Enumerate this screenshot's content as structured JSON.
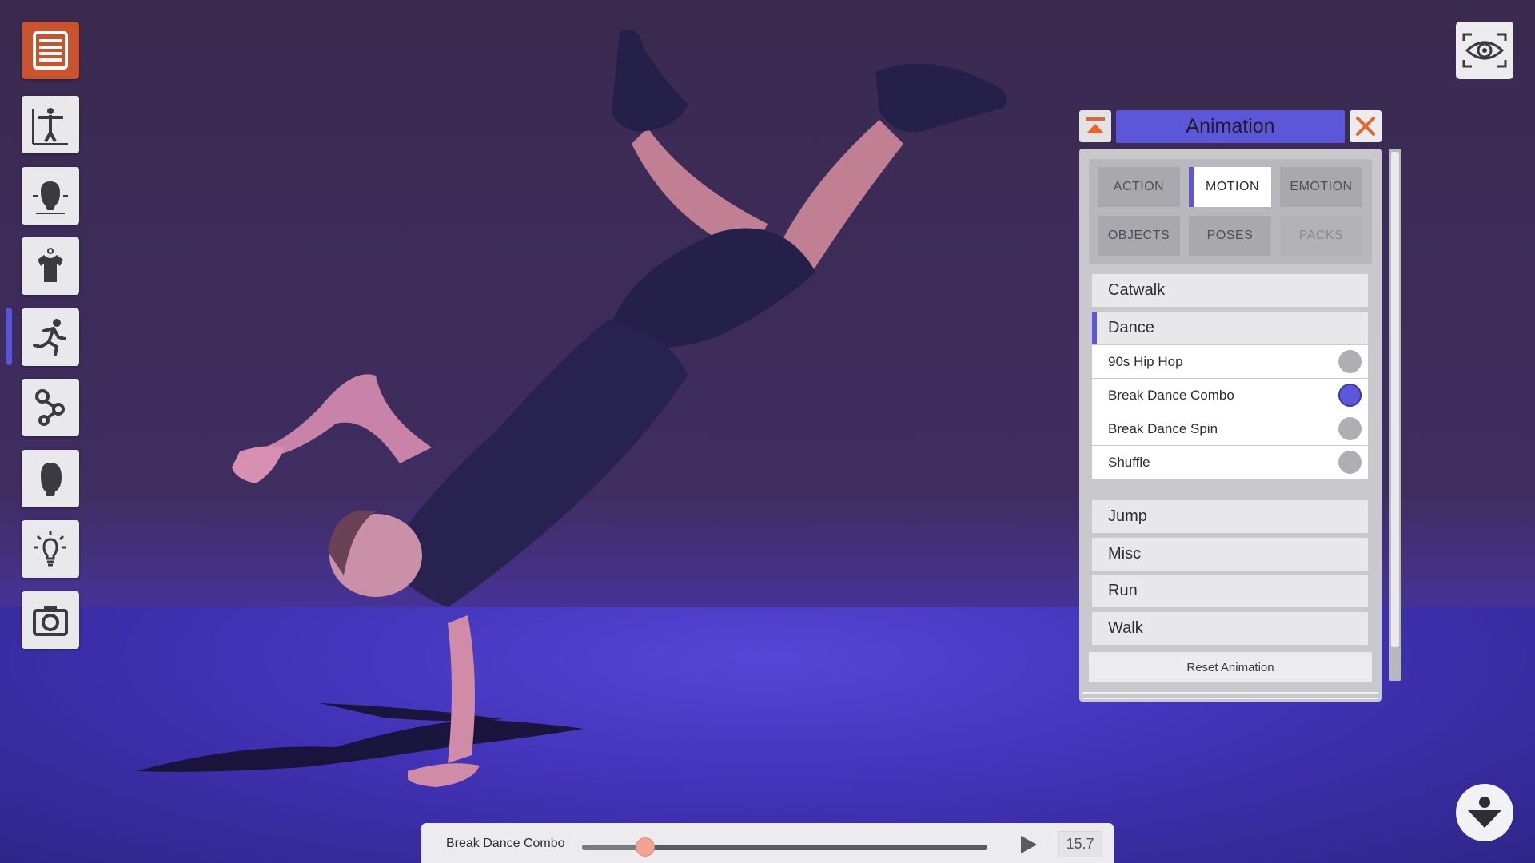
{
  "toolbar": {
    "items": [
      {
        "icon": "menu-icon"
      },
      {
        "icon": "body-proportions-icon"
      },
      {
        "icon": "head-proportions-icon"
      },
      {
        "icon": "clothing-icon"
      },
      {
        "icon": "animation-runner-icon"
      },
      {
        "icon": "joints-icon"
      },
      {
        "icon": "head-icon"
      },
      {
        "icon": "lighting-icon"
      },
      {
        "icon": "camera-icon"
      }
    ],
    "active_index": 4
  },
  "view": {
    "eye_icon": "eye-icon"
  },
  "panel": {
    "title": "Animation",
    "tabs": [
      {
        "label": "ACTION",
        "state": "normal"
      },
      {
        "label": "MOTION",
        "state": "active"
      },
      {
        "label": "EMOTION",
        "state": "normal"
      },
      {
        "label": "OBJECTS",
        "state": "normal"
      },
      {
        "label": "POSES",
        "state": "normal"
      },
      {
        "label": "PACKS",
        "state": "disabled"
      }
    ],
    "categories_top": [
      {
        "label": "Catwalk"
      },
      {
        "label": "Dance",
        "expanded": true
      }
    ],
    "dance_items": [
      {
        "label": "90s Hip Hop",
        "selected": false
      },
      {
        "label": "Break Dance Combo",
        "selected": true
      },
      {
        "label": "Break Dance Spin",
        "selected": false
      },
      {
        "label": "Shuffle",
        "selected": false
      }
    ],
    "categories_bottom": [
      {
        "label": "Jump"
      },
      {
        "label": "Misc"
      },
      {
        "label": "Run"
      },
      {
        "label": "Walk"
      }
    ],
    "reset_label": "Reset Animation"
  },
  "playback": {
    "animation_name": "Break Dance Combo",
    "progress": 0.155,
    "time": "15.7"
  },
  "colors": {
    "accent": "#5c56d8",
    "menu_button": "#c9532f",
    "close_x": "#e8642c"
  }
}
